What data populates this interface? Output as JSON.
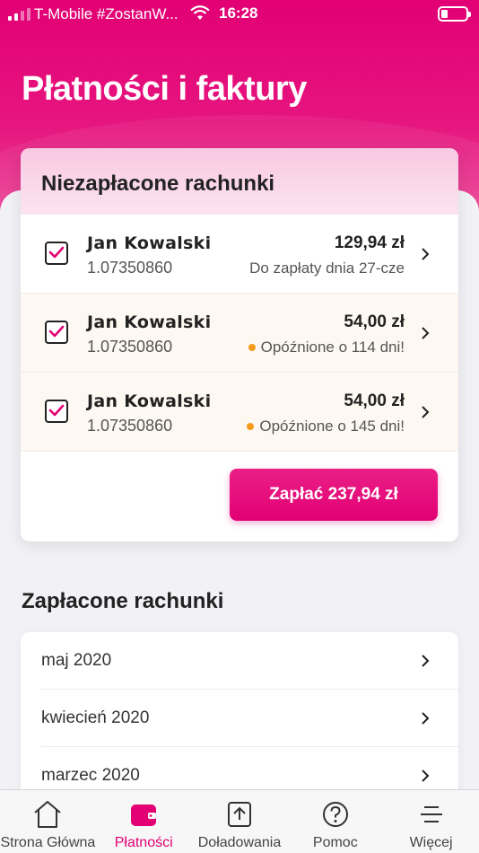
{
  "status_bar": {
    "carrier": "T-Mobile #ZostanW...",
    "time": "16:28"
  },
  "page_title": "Płatności i faktury",
  "unpaid": {
    "title": "Niezapłacone rachunki",
    "bills": [
      {
        "name": "Jan Kowalski",
        "account": "1.07350860",
        "amount": "129,94 zł",
        "status": "Do zapłaty dnia 27-cze",
        "overdue": false,
        "checked": true
      },
      {
        "name": "Jan Kowalski",
        "account": "1.07350860",
        "amount": "54,00 zł",
        "status": "Opóźnione o 114  dni!",
        "overdue": true,
        "checked": true
      },
      {
        "name": "Jan Kowalski",
        "account": "1.07350860",
        "amount": "54,00 zł",
        "status": "Opóźnione o 145  dni!",
        "overdue": true,
        "checked": true
      }
    ],
    "pay_button": "Zapłać 237,94 zł"
  },
  "paid": {
    "title": "Zapłacone rachunki",
    "months": [
      "maj 2020",
      "kwiecień 2020",
      "marzec 2020"
    ]
  },
  "tabs": [
    {
      "label": "Strona Główna",
      "icon": "home-icon"
    },
    {
      "label": "Płatności",
      "icon": "wallet-icon",
      "active": true
    },
    {
      "label": "Doładowania",
      "icon": "topup-icon"
    },
    {
      "label": "Pomoc",
      "icon": "help-icon"
    },
    {
      "label": "Więcej",
      "icon": "menu-icon"
    }
  ],
  "colors": {
    "brand": "#e20074",
    "overdue_dot": "#f59a1b"
  }
}
